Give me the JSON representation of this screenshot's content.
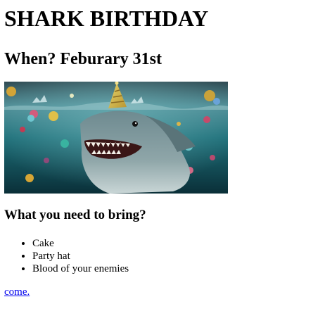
{
  "page": {
    "title": "SHARK BIRTHDAY",
    "when": "When? Feburary 31st",
    "hero_image": {
      "icon": "party-shark-image"
    },
    "bring_heading": "What you need to bring?",
    "bring_items": [
      "Cake",
      "Party hat",
      "Blood of your enemies"
    ],
    "link_text": "come."
  },
  "colors": {
    "link": "#0000ee",
    "text": "#000000",
    "background": "#ffffff"
  }
}
